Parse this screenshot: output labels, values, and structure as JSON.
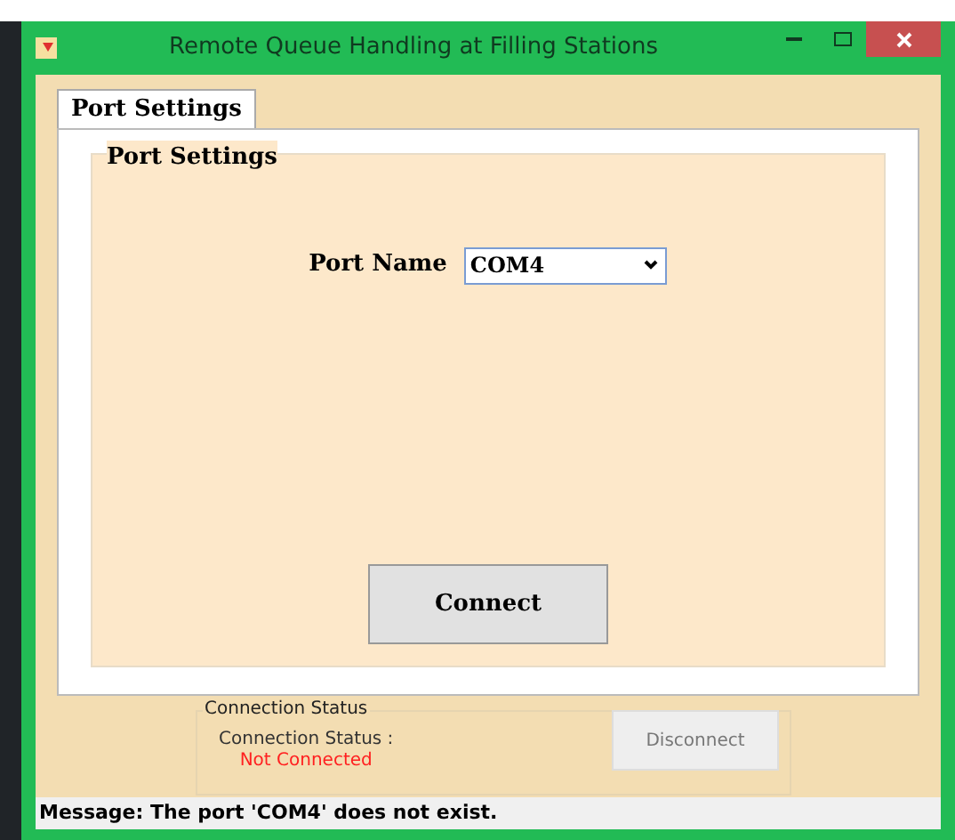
{
  "window": {
    "title": "Remote Queue Handling at Filling Stations"
  },
  "tabs": [
    {
      "label": "Port Settings",
      "selected": true
    }
  ],
  "port_settings": {
    "group_title": "Port Settings",
    "port_name_label": "Port Name",
    "port_name_value": "COM4",
    "connect_button": "Connect"
  },
  "connection_status": {
    "group_title": "Connection Status",
    "label": "Connection Status :",
    "value": "Not Connected",
    "disconnect_button": {
      "label": "Disconnect",
      "disabled": true
    }
  },
  "status_bar": {
    "message": "Message: The port 'COM4' does not exist."
  }
}
